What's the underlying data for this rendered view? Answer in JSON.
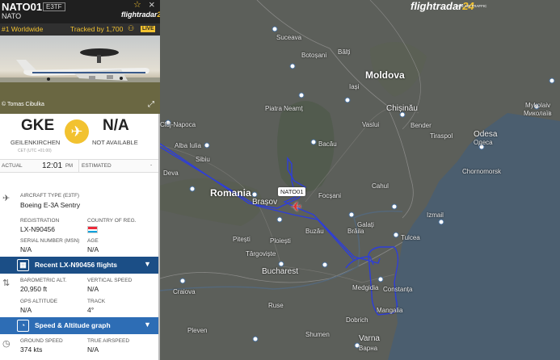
{
  "header": {
    "callsign": "NATO01",
    "badge": "E3TF",
    "operator": "NATO",
    "logo_main": "flightradar",
    "logo_num": "24",
    "star_icon": "star-icon",
    "close_icon": "close-icon"
  },
  "rank_bar": {
    "rank": "#1 Worldwide",
    "tracked": "Tracked by 1,700",
    "live": "LIVE"
  },
  "photo": {
    "credit": "© Tomas Cibulka"
  },
  "route": {
    "origin_code": "GKE",
    "origin_city": "GEILENKIRCHEN",
    "origin_tz": "CET (UTC +01:00)",
    "dest_code": "N/A",
    "dest_city": "NOT AVAILABLE"
  },
  "times": {
    "actual_label": "ACTUAL",
    "actual_time": "12:01",
    "actual_ampm": "PM",
    "est_label": "ESTIMATED",
    "est_value": "-"
  },
  "aircraft": {
    "type_label": "AIRCRAFT TYPE (E3TF)",
    "type_value": "Boeing E-3A Sentry",
    "reg_label": "REGISTRATION",
    "reg_value": "LX-N90456",
    "country_label": "COUNTRY OF REG.",
    "country_flag": "luxembourg-flag",
    "serial_label": "SERIAL NUMBER (MSN)",
    "serial_value": "N/A",
    "age_label": "AGE",
    "age_value": "N/A"
  },
  "recent_section": {
    "title": "Recent LX-N90456 flights"
  },
  "flight_data": {
    "baro_label": "BAROMETRIC ALT.",
    "baro_value": "20,950 ft",
    "vspeed_label": "VERTICAL SPEED",
    "vspeed_value": "N/A",
    "gps_label": "GPS ALTITUDE",
    "gps_value": "N/A",
    "track_label": "TRACK",
    "track_value": "4°"
  },
  "speed_section": {
    "title": "Speed & Altitude graph"
  },
  "speed_data": {
    "gs_label": "GROUND SPEED",
    "gs_value": "374 kts",
    "tas_label": "TRUE AIRSPEED",
    "tas_value": "N/A"
  },
  "map": {
    "logo_main": "flightradar",
    "logo_num": "24",
    "logo_sub": "LIVE AIR TRAFFIC",
    "callout": "NATO01",
    "labels": {
      "romania": "Romania",
      "moldova": "Moldova",
      "chisinau": "Chișinău",
      "odesa": "Odesa",
      "odesa_cyr": "Одеса",
      "mykolaiv": "Mykolaiv",
      "mykolaiv_cyr": "Миколаїв",
      "bucharest": "Bucharest",
      "brasov": "Brașov",
      "ploiesti": "Ploiești",
      "buzau": "Buzău",
      "galati": "Galați",
      "constanta": "Constanța",
      "mangalia": "Mangalia",
      "varna": "Varna",
      "varna_cyr": "Варна",
      "dobrich": "Dobrich",
      "cluj": "Cluj-Napoca",
      "sibiu": "Sibiu",
      "pitesti": "Pitești",
      "targoviste": "Târgoviște",
      "craiova": "Craiova",
      "suceava": "Suceava",
      "botosani": "Botoșani",
      "iasi": "Iași",
      "bacau": "Bacău",
      "piatra": "Piatra Neamț",
      "bender": "Bender",
      "tiraspol": "Tiraspol",
      "tulcea": "Tulcea",
      "braila": "Brăila",
      "medgidia": "Medgidia",
      "ruse": "Ruse",
      "pleven": "Pleven",
      "shumen": "Shumen",
      "izmail": "Izmail",
      "cahul": "Cahul",
      "balti": "Bălți",
      "chernomorsk": "Chornomorsk",
      "alba": "Alba Iulia",
      "deva": "Deva",
      "focsani": "Focșani",
      "vaslui": "Vaslui"
    }
  }
}
